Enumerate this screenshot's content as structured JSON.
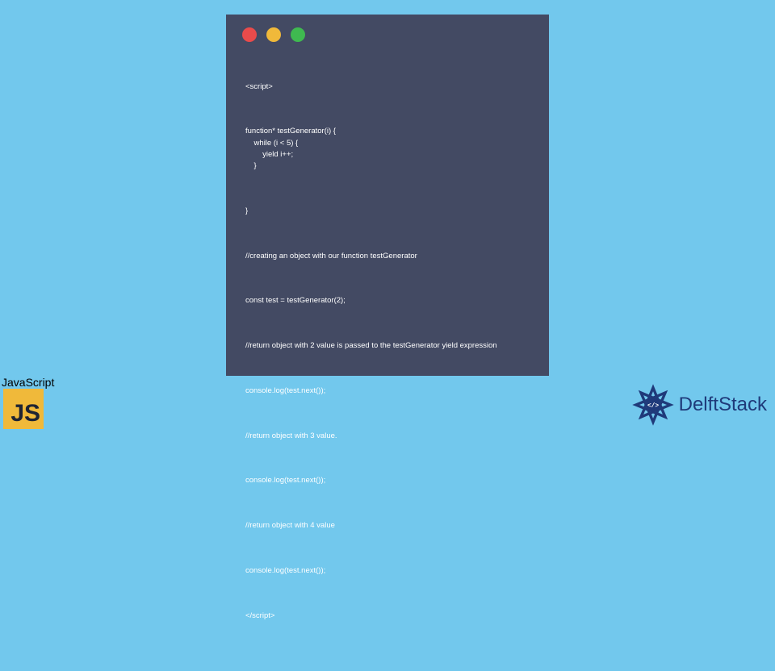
{
  "code": {
    "l1": "<script>",
    "l2": "function* testGenerator(i) {\n    while (i < 5) {\n        yield i++;\n    }",
    "l3": "}",
    "l4": "//creating an object with our function testGenerator",
    "l5": "const test = testGenerator(2);",
    "l6": "//return object with 2 value is passed to the testGenerator yield expression",
    "l7": "console.log(test.next());",
    "l8": "//return object with 3 value.",
    "l9": "console.log(test.next());",
    "l10": "//return object with 4 value",
    "l11": "console.log(test.next());",
    "l12": "</script>"
  },
  "js_badge": {
    "label": "JavaScript",
    "letter1": "J",
    "letter2": "S"
  },
  "brand": {
    "name": "DelftStack"
  },
  "colors": {
    "page_bg": "#72c8ed",
    "window_bg": "#434a63",
    "dot_red": "#e94b4b",
    "dot_yellow": "#f0b93a",
    "dot_green": "#3fb950",
    "js_bg": "#f0b93a",
    "brand_color": "#1f3a7a"
  }
}
